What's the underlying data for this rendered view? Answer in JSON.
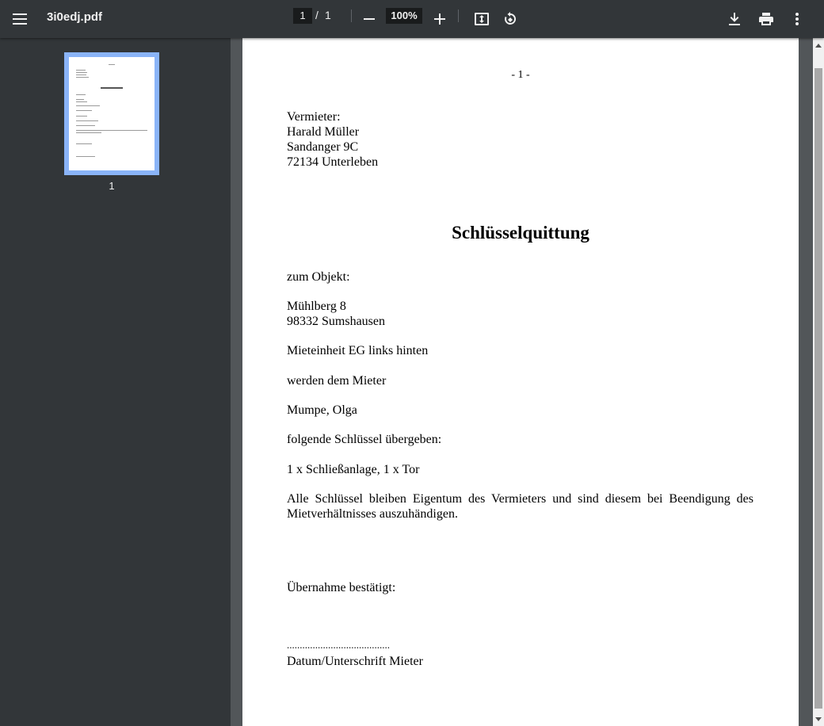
{
  "toolbar": {
    "menu_icon": "menu-icon",
    "title": "3i0edj.pdf",
    "page_current": "1",
    "page_separator": "/",
    "page_total": "1",
    "zoom_value": "100%",
    "icons": [
      "zoom-out-icon",
      "zoom-in-icon",
      "fit-page-icon",
      "rotate-icon",
      "download-icon",
      "print-icon",
      "more-vert-icon"
    ]
  },
  "sidebar": {
    "thumbnail_number": "1"
  },
  "document": {
    "page_label": "- 1 -",
    "landlord_label": "Vermieter:",
    "landlord_name": "Harald Müller",
    "landlord_street": "Sandanger 9C",
    "landlord_city": "72134 Unterleben",
    "title": "Schlüsselquittung",
    "object_label": "zum Objekt:",
    "object_street": "Mühlberg 8",
    "object_city": "98332 Sumshausen",
    "unit": "Mieteinheit EG links hinten",
    "tenant_intro": "werden dem Mieter",
    "tenant_name": "Mumpe, Olga",
    "keys_intro": "folgende Schlüssel übergeben:",
    "keys": "1 x Schließanlage, 1 x Tor",
    "notice": "Alle Schlüssel bleiben Eigentum des Vermieters und sind diesem bei Beendigung des Mietverhältnisses auszuhändigen.",
    "confirmation": "Übernahme bestätigt:",
    "signature_line": "........................................",
    "signature_label": "Datum/Unterschrift Mieter"
  },
  "colors": {
    "toolbar_bg": "#323639",
    "viewer_bg": "#525659",
    "thumb_selected": "#8ab4f8"
  }
}
